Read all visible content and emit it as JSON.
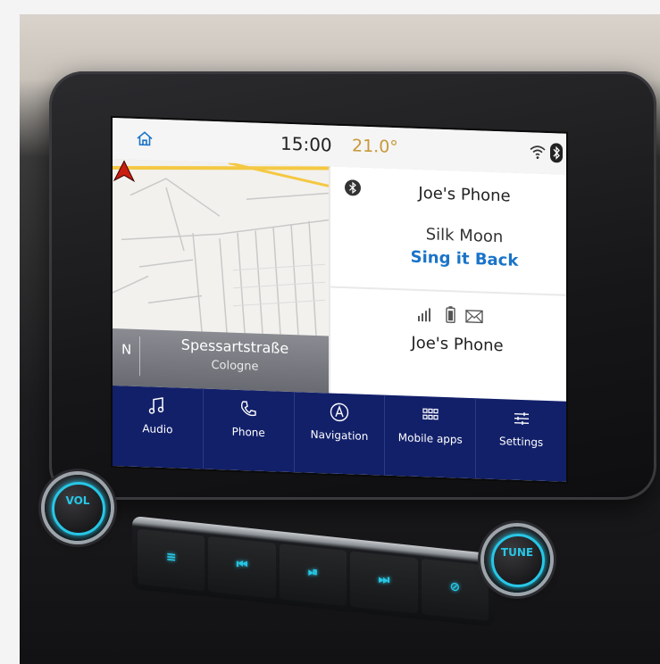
{
  "statusbar": {
    "time": "15:00",
    "temperature": "21.0°"
  },
  "map": {
    "compass": "N",
    "street": "Spessartstraße",
    "city": "Cologne"
  },
  "media_panel": {
    "device": "Joe's Phone",
    "artist": "Silk Moon",
    "song": "Sing it Back"
  },
  "phone_panel": {
    "device": "Joe's Phone"
  },
  "nav": [
    {
      "label": "Audio",
      "icon": "music-note-icon"
    },
    {
      "label": "Phone",
      "icon": "phone-icon"
    },
    {
      "label": "Navigation",
      "icon": "navigation-icon"
    },
    {
      "label": "Mobile apps",
      "icon": "apps-grid-icon"
    },
    {
      "label": "Settings",
      "icon": "settings-sliders-icon"
    }
  ],
  "hardware": {
    "vol_label": "VOL",
    "tune_label": "TUNE",
    "buttons": [
      "≡",
      "⏮",
      "⏯",
      "⏭",
      "⊘"
    ]
  },
  "colors": {
    "nav_bg": "#12206a",
    "accent_link": "#1a74c8",
    "temperature": "#c79a3a",
    "ambient_light": "#27c7e6"
  }
}
